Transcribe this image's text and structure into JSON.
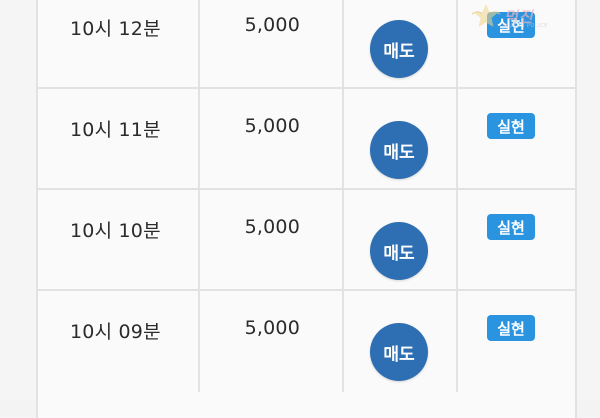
{
  "rows": [
    {
      "time": "10시 12분",
      "quantity": "5,000",
      "action_label": "매도",
      "status": "실현"
    },
    {
      "time": "10시 11분",
      "quantity": "5,000",
      "action_label": "매도",
      "status": "실현"
    },
    {
      "time": "10시 10분",
      "quantity": "5,000",
      "action_label": "매도",
      "status": "실현"
    },
    {
      "time": "10시 09분",
      "quantity": "5,000",
      "action_label": "매도",
      "status": "실현"
    }
  ],
  "watermark": {
    "logo_text": "먹진",
    "logo_subtext": "MUKJIN POLICE"
  },
  "colors": {
    "sell_button": "#2e6fb3",
    "status_badge": "#2b94e0",
    "background": "#f5f5f5"
  }
}
